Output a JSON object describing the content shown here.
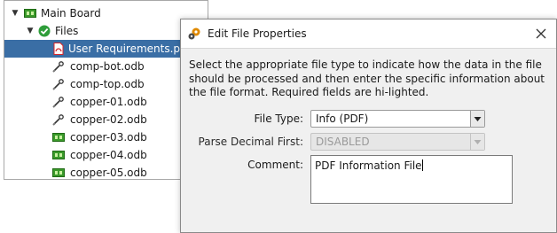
{
  "tree": {
    "root": {
      "label": "Main Board",
      "icon": "circuit-board-icon",
      "expanded": true
    },
    "folder": {
      "label": "Files",
      "icon": "check-circle-icon",
      "expanded": true
    },
    "items": [
      {
        "label": "User Requirements.pdf",
        "icon": "pdf-file-icon",
        "selected": true
      },
      {
        "label": "comp-bot.odb",
        "icon": "probe-icon"
      },
      {
        "label": "comp-top.odb",
        "icon": "probe-icon"
      },
      {
        "label": "copper-01.odb",
        "icon": "probe-icon"
      },
      {
        "label": "copper-02.odb",
        "icon": "probe-icon"
      },
      {
        "label": "copper-03.odb",
        "icon": "circuit-board-icon"
      },
      {
        "label": "copper-04.odb",
        "icon": "circuit-board-icon"
      },
      {
        "label": "copper-05.odb",
        "icon": "circuit-board-icon"
      }
    ]
  },
  "dialog": {
    "title": "Edit File Properties",
    "title_icon": "gears-icon",
    "close_icon": "close-icon",
    "description": "Select the appropriate file type to indicate how the data in the file should be processed and then enter the specific information about the file format. Required fields are hi-lighted.",
    "file_type": {
      "label": "File Type:",
      "value": "Info (PDF)"
    },
    "parse_decimal": {
      "label": "Parse Decimal First:",
      "value": "DISABLED",
      "disabled": true
    },
    "comment": {
      "label": "Comment:",
      "value": "PDF Information File"
    }
  },
  "colors": {
    "selection": "#3a6ea5",
    "board_green": "#3a9a2a",
    "check_green": "#2e9d3a",
    "pdf_red": "#d8262a",
    "gear_orange": "#e08a00"
  }
}
